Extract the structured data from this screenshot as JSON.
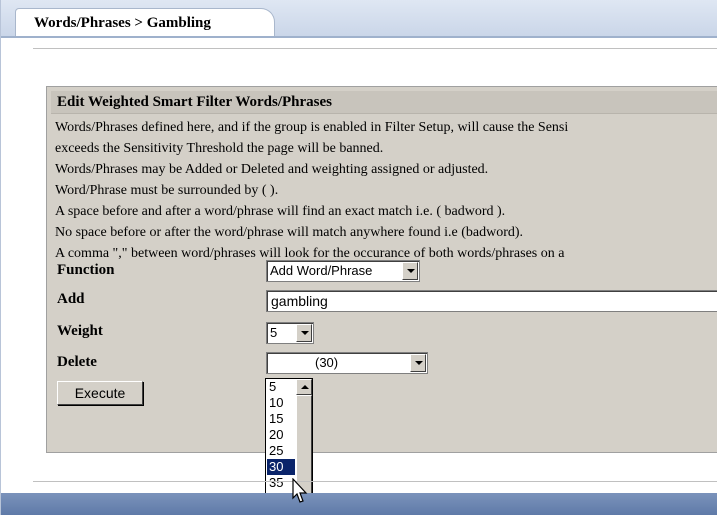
{
  "tab": {
    "label": "Words/Phrases > Gambling"
  },
  "panel": {
    "title": "Edit Weighted Smart Filter Words/Phrases",
    "description": [
      "Words/Phrases defined here, and if the group is enabled in Filter Setup, will cause the Sensi",
      "exceeds the Sensitivity Threshold the page will be banned.",
      "Words/Phrases may be Added or Deleted and weighting assigned or adjusted.",
      "Word/Phrase must be surrounded by ( ).",
      "A space before and after a word/phrase will find an exact match i.e. ( badword ).",
      "No space before or after the word/phrase will match anywhere found i.e (badword).",
      "A comma \",\" between word/phrases will look for the occurance of both words/phrases on a"
    ]
  },
  "form": {
    "function_label": "Function",
    "function_value": "Add Word/Phrase",
    "add_label": "Add",
    "add_value": "gambling",
    "weight_label": "Weight",
    "weight_value": "5",
    "delete_label": "Delete",
    "delete_value": "(30)",
    "execute_label": "Execute"
  },
  "weight_dropdown": {
    "options": [
      "5",
      "10",
      "15",
      "20",
      "25",
      "30",
      "35"
    ],
    "highlighted": "30"
  }
}
